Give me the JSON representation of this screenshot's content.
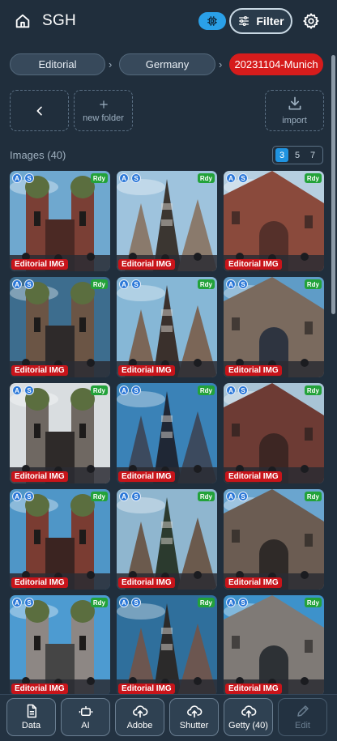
{
  "header": {
    "title": "SGH",
    "filter_label": "Filter",
    "icons": {
      "home": "home-icon",
      "chip": "chip-icon",
      "filter": "sliders-icon",
      "settings": "gear-icon"
    }
  },
  "breadcrumb": [
    {
      "label": "Editorial",
      "active": false
    },
    {
      "label": "Germany",
      "active": false
    },
    {
      "label": "20231104-Munich",
      "active": true
    }
  ],
  "actions": {
    "back_icon": "chevron-left-icon",
    "new_folder_label": "new folder",
    "import_label": "import"
  },
  "images": {
    "label": "Images (40)",
    "columns_options": [
      "3",
      "5",
      "7"
    ],
    "columns_selected": "3",
    "tile_badges": {
      "a": "A",
      "s": "S",
      "status": "Rdy",
      "category": "Editorial IMG"
    },
    "tiles": [
      {
        "scene": "frauenkirche-towers"
      },
      {
        "scene": "rathaus-square"
      },
      {
        "scene": "cathedral-doorway"
      },
      {
        "scene": "street-crowd"
      },
      {
        "scene": "market-facade"
      },
      {
        "scene": "rathaus-crowd"
      },
      {
        "scene": "cafe-umbrellas"
      },
      {
        "scene": "rathaus-tower-wide"
      },
      {
        "scene": "gothic-doorway"
      },
      {
        "scene": "frauenkirche-low"
      },
      {
        "scene": "phone-photo"
      },
      {
        "scene": "building-corner"
      },
      {
        "scene": "rathaus-tower"
      },
      {
        "scene": "church-tower-dark"
      },
      {
        "scene": "rathaus-square-crowd"
      }
    ]
  },
  "bottom_nav": [
    {
      "label": "Data",
      "icon": "document-icon",
      "enabled": true
    },
    {
      "label": "AI",
      "icon": "robot-icon",
      "enabled": true
    },
    {
      "label": "Adobe",
      "icon": "cloud-upload-icon",
      "enabled": true
    },
    {
      "label": "Shutter",
      "icon": "cloud-upload-icon",
      "enabled": true
    },
    {
      "label": "Getty (40)",
      "icon": "cloud-upload-icon",
      "enabled": true
    },
    {
      "label": "Edit",
      "icon": "pencil-icon",
      "enabled": false
    }
  ],
  "colors": {
    "accent": "#2aa0e8",
    "active_crumb": "#d61c1c",
    "ready": "#23a23a",
    "editorial": "#c8141a",
    "background": "#202e3c"
  }
}
